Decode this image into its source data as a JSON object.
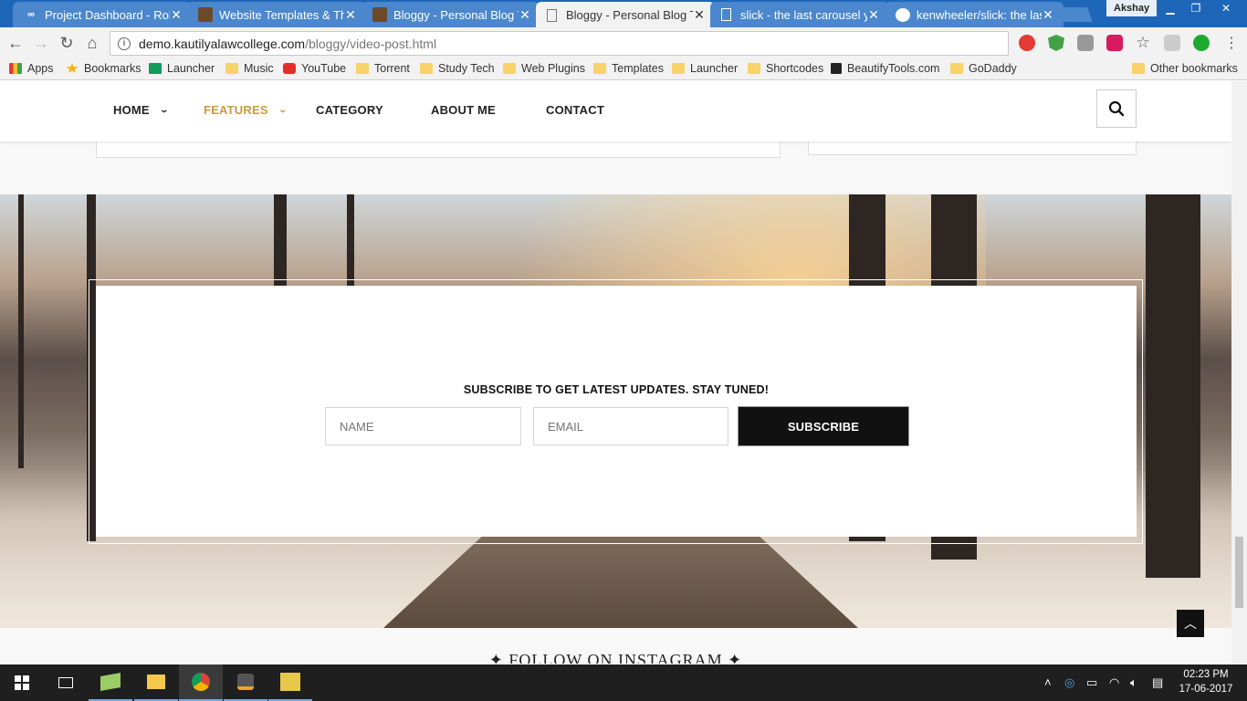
{
  "browser": {
    "tabs": [
      {
        "title": "Project Dashboard - Rob",
        "favicon": "infinity-icon"
      },
      {
        "title": "Website Templates & Th",
        "favicon": "site-icon"
      },
      {
        "title": "Bloggy - Personal Blog T",
        "favicon": "site-icon"
      },
      {
        "title": "Bloggy - Personal Blog T",
        "favicon": "page-icon",
        "active": true
      },
      {
        "title": "slick - the last carousel y",
        "favicon": "page-icon"
      },
      {
        "title": "kenwheeler/slick: the las",
        "favicon": "github-icon"
      }
    ],
    "profile_name": "Akshay",
    "address": {
      "host": "demo.kautilyalawcollege.com",
      "path": "/bloggy/video-post.html"
    },
    "bookmarks": [
      "Apps",
      "Bookmarks",
      "Launcher",
      "Music",
      "YouTube",
      "Torrent",
      "Study Tech",
      "Web Plugins",
      "Templates",
      "Launcher",
      "Shortcodes",
      "BeautifyTools.com",
      "GoDaddy"
    ],
    "other_bookmarks": "Other bookmarks"
  },
  "site": {
    "nav": [
      {
        "label": "HOME",
        "has_dropdown": true
      },
      {
        "label": "FEATURES",
        "has_dropdown": true,
        "active": true
      },
      {
        "label": "CATEGORY",
        "has_dropdown": false
      },
      {
        "label": "ABOUT ME",
        "has_dropdown": false
      },
      {
        "label": "CONTACT",
        "has_dropdown": false
      }
    ],
    "accent_color": "#c89b3c",
    "subscribe": {
      "heading": "SUBSCRIBE TO GET LATEST UPDATES. STAY TUNED!",
      "name_placeholder": "NAME",
      "email_placeholder": "EMAIL",
      "button_label": "SUBSCRIBE"
    },
    "instagram_heading": "FOLLOW ON INSTAGRAM"
  },
  "taskbar": {
    "time": "02:23 PM",
    "date": "17-06-2017"
  }
}
